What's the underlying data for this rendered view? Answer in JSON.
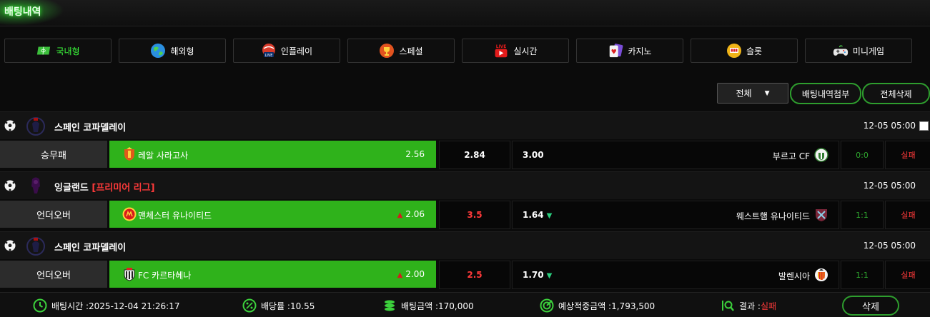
{
  "page": {
    "title": "배팅내역"
  },
  "tabs": [
    {
      "label": "국내형",
      "icon": "soccer-field-icon",
      "active": true
    },
    {
      "label": "해외형",
      "icon": "globe-icon"
    },
    {
      "label": "인플레이",
      "icon": "live-ball-icon"
    },
    {
      "label": "스페셜",
      "icon": "trophy-icon"
    },
    {
      "label": "실시간",
      "icon": "live-video-icon"
    },
    {
      "label": "카지노",
      "icon": "cards-icon"
    },
    {
      "label": "슬롯",
      "icon": "slot-machine-icon"
    },
    {
      "label": "미니게임",
      "icon": "gamepad-icon"
    }
  ],
  "toolbar": {
    "filter_value": "전체",
    "attach_label": "배팅내역첨부",
    "delete_all_label": "전체삭제"
  },
  "bets": [
    {
      "league": "스페인 코파델레이",
      "league_tag": "",
      "datetime": "12-05 05:00",
      "show_checkbox": true,
      "type": "승무패",
      "home_team": "레알 사라고사",
      "home_odds": "2.56",
      "home_arrow": "",
      "mid": "2.84",
      "mid_red": false,
      "away_odds": "3.00",
      "away_arrow": "",
      "away_team": "부르고 CF",
      "score": "0:0",
      "result": "실패"
    },
    {
      "league": "잉글랜드",
      "league_tag": "[프리미어 리그]",
      "datetime": "12-05 05:00",
      "show_checkbox": false,
      "type": "언더오버",
      "home_team": "맨체스터 유나이티드",
      "home_odds": "2.06",
      "home_arrow": "▲",
      "mid": "3.5",
      "mid_red": true,
      "away_odds": "1.64",
      "away_arrow": "▼",
      "away_team": "웨스트햄 유나이티드",
      "score": "1:1",
      "result": "실패"
    },
    {
      "league": "스페인 코파델레이",
      "league_tag": "",
      "datetime": "12-05 05:00",
      "show_checkbox": false,
      "type": "언더오버",
      "home_team": "FC 카르타헤나",
      "home_odds": "2.00",
      "home_arrow": "▲",
      "mid": "2.5",
      "mid_red": true,
      "away_odds": "1.70",
      "away_arrow": "▼",
      "away_team": "발렌시아",
      "score": "1:1",
      "result": "실패"
    }
  ],
  "footer": {
    "bet_time_label": "배팅시간 :",
    "bet_time": "2025-12-04 21:26:17",
    "odds_label": "배당률 :",
    "odds": "10.55",
    "amount_label": "배팅금액 :",
    "amount": "170,000",
    "expected_label": "예상적중금액 :",
    "expected": "1,793,500",
    "result_label": "결과 :",
    "result": "실패",
    "delete_label": "삭제"
  },
  "colors": {
    "accent_green": "#2fb21b",
    "result_red": "#ff3a3a",
    "pill_border": "#2e9e2e"
  }
}
